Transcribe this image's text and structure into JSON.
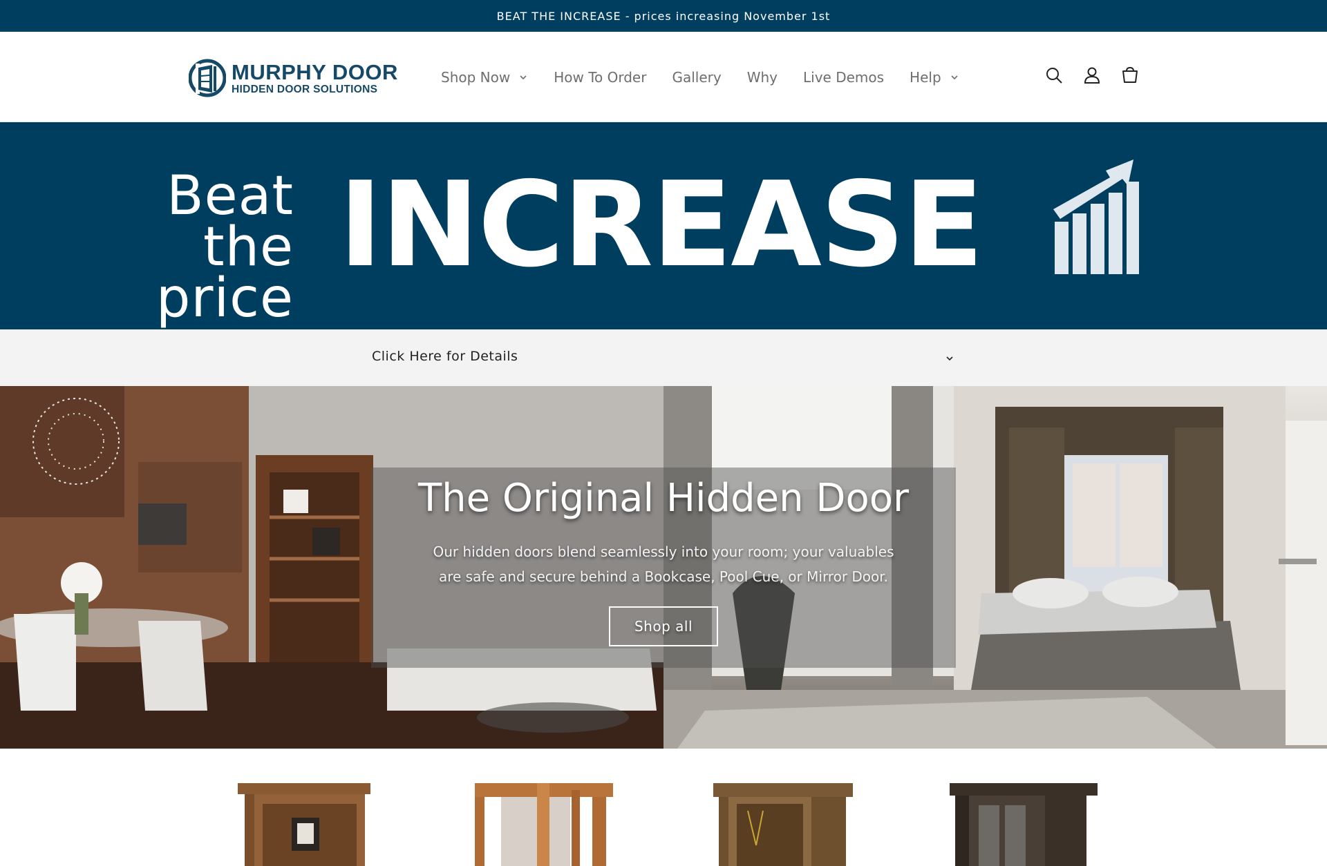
{
  "announcement": {
    "text": "BEAT THE INCREASE - prices increasing November 1st"
  },
  "header": {
    "logo": {
      "line1": "MURPHY DOOR",
      "line2": "HIDDEN DOOR SOLUTIONS",
      "registered": "®"
    },
    "nav": [
      {
        "label": "Shop Now",
        "has_dropdown": true
      },
      {
        "label": "How To Order",
        "has_dropdown": false
      },
      {
        "label": "Gallery",
        "has_dropdown": false
      },
      {
        "label": "Why",
        "has_dropdown": false
      },
      {
        "label": "Live Demos",
        "has_dropdown": false
      },
      {
        "label": "Help",
        "has_dropdown": true
      }
    ],
    "icons": [
      "search-icon",
      "account-icon",
      "cart-icon"
    ]
  },
  "banner": {
    "line1": "Beat the",
    "line2": "price",
    "headline": "INCREASE",
    "icon": "rising-chart-icon"
  },
  "details": {
    "label": "Click Here for Details",
    "icon": "chevron-down-icon"
  },
  "hero": {
    "title": "The Original Hidden Door",
    "subtitle_line1": "Our hidden doors blend seamlessly into your room; your valuables",
    "subtitle_line2": "are safe and secure behind a Bookcase, Pool Cue, or Mirror Door.",
    "button": "Shop all"
  },
  "products": [
    {
      "name": "bookcase-door-product"
    },
    {
      "name": "flush-mount-door-product"
    },
    {
      "name": "pool-cue-door-product"
    },
    {
      "name": "dark-door-product"
    }
  ],
  "colors": {
    "brand_navy": "#003e5f",
    "logo_blue": "#154968",
    "details_bg": "#f3f3f3"
  }
}
